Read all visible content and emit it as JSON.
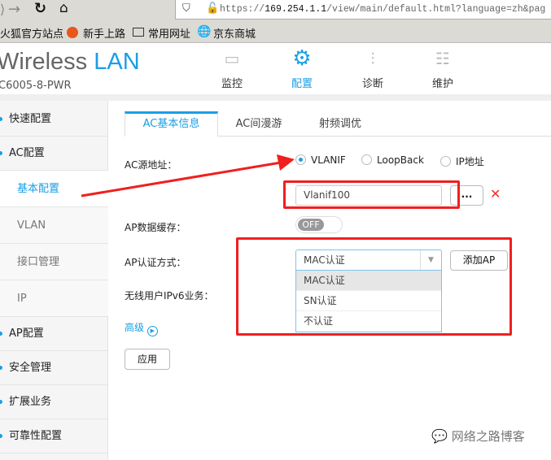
{
  "browser": {
    "url_prefix": "https://",
    "url_host": "169.254.1.1",
    "url_rest": "/view/main/default.html?language=zh&pag",
    "bookmarks": [
      "火狐官方站点",
      "新手上路",
      "常用网址",
      "京东商城"
    ]
  },
  "header": {
    "brand_main": "Wireless",
    "brand_accent": "LAN",
    "model": "C6005-8-PWR",
    "nav": [
      {
        "label": "监控",
        "icon": "monitor-icon"
      },
      {
        "label": "配置",
        "icon": "gear-icon"
      },
      {
        "label": "诊断",
        "icon": "sliders-icon"
      },
      {
        "label": "维护",
        "icon": "server-gear-icon"
      }
    ],
    "active_nav": "配置"
  },
  "sidebar": {
    "items": [
      "快速配置",
      "AC配置",
      "基本配置",
      "VLAN",
      "接口管理",
      "IP",
      "AP配置",
      "安全管理",
      "扩展业务",
      "可靠性配置"
    ],
    "active": "基本配置"
  },
  "tabs": [
    "AC基本信息",
    "AC间漫游",
    "射频调优"
  ],
  "form": {
    "ac_source_label": "AC源地址：",
    "radio_options": [
      "VLANIF",
      "LoopBack",
      "IP地址"
    ],
    "radio_selected": "VLANIF",
    "vlanif_value": "Vlanif100",
    "browse_label": "...",
    "clear_icon": "✕",
    "ap_cache_label": "AP数据缓存：",
    "ap_cache_state": "OFF",
    "ap_auth_label": "AP认证方式：",
    "ap_auth_value": "MAC认证",
    "add_ap_label": "添加AP",
    "auth_options": [
      "MAC认证",
      "SN认证",
      "不认证"
    ],
    "ipv6_label": "无线用户IPv6业务：",
    "advanced_label": "高级",
    "apply_label": "应用"
  },
  "watermark": "网络之路博客",
  "colors": {
    "accent": "#1a9ee5",
    "annotation": "#f01f1f"
  }
}
